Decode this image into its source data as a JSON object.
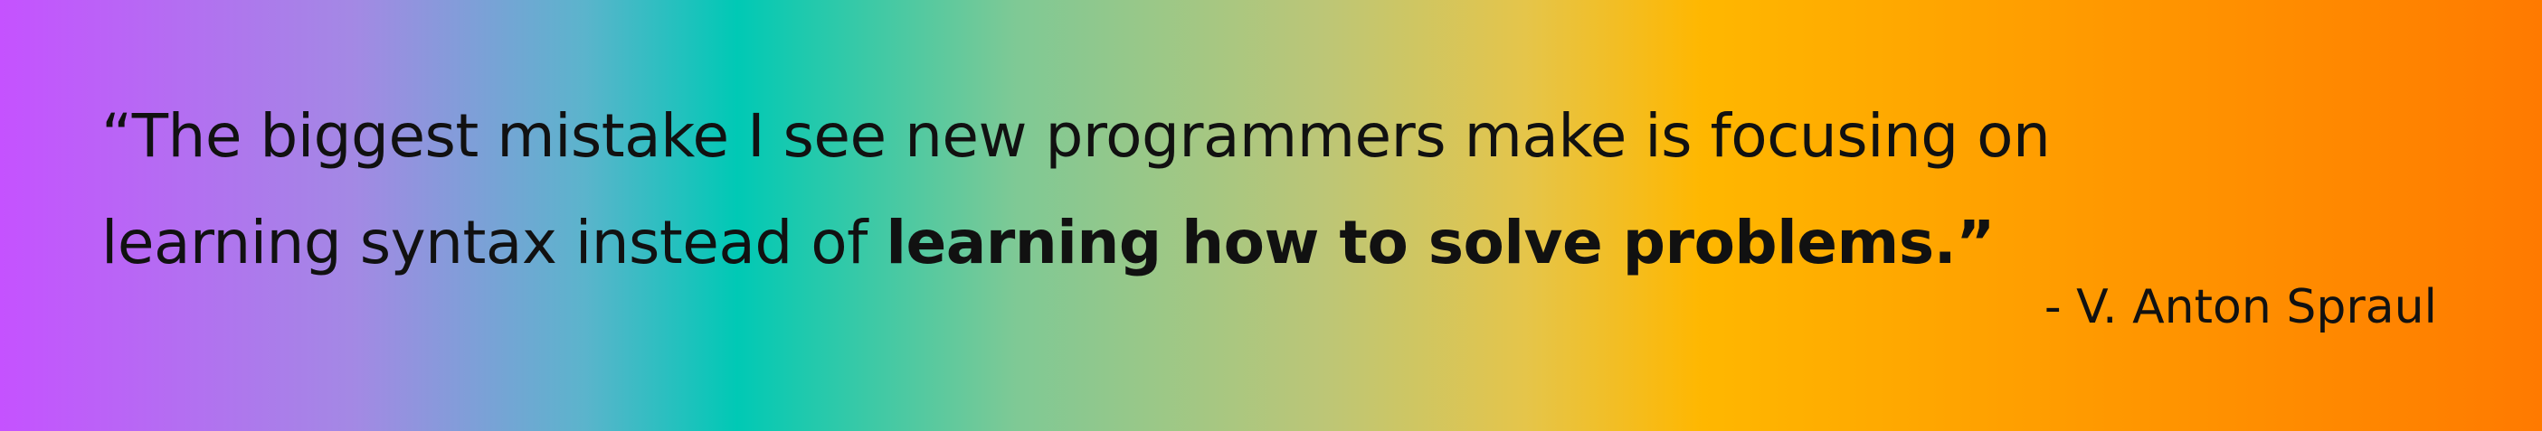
{
  "quote": {
    "line1": "“The biggest mistake I see new programmers make is focusing on",
    "line2_regular": "learning syntax instead of ",
    "line2_bold": "learning how to solve problems.”"
  },
  "attribution": "- V. Anton Spraul",
  "colors": {
    "text": "#111111",
    "gradient_start": "#c552ff",
    "gradient_mid_teal": "#00c9b5",
    "gradient_mid_yellow": "#ffb700",
    "gradient_end": "#ff7a00"
  }
}
